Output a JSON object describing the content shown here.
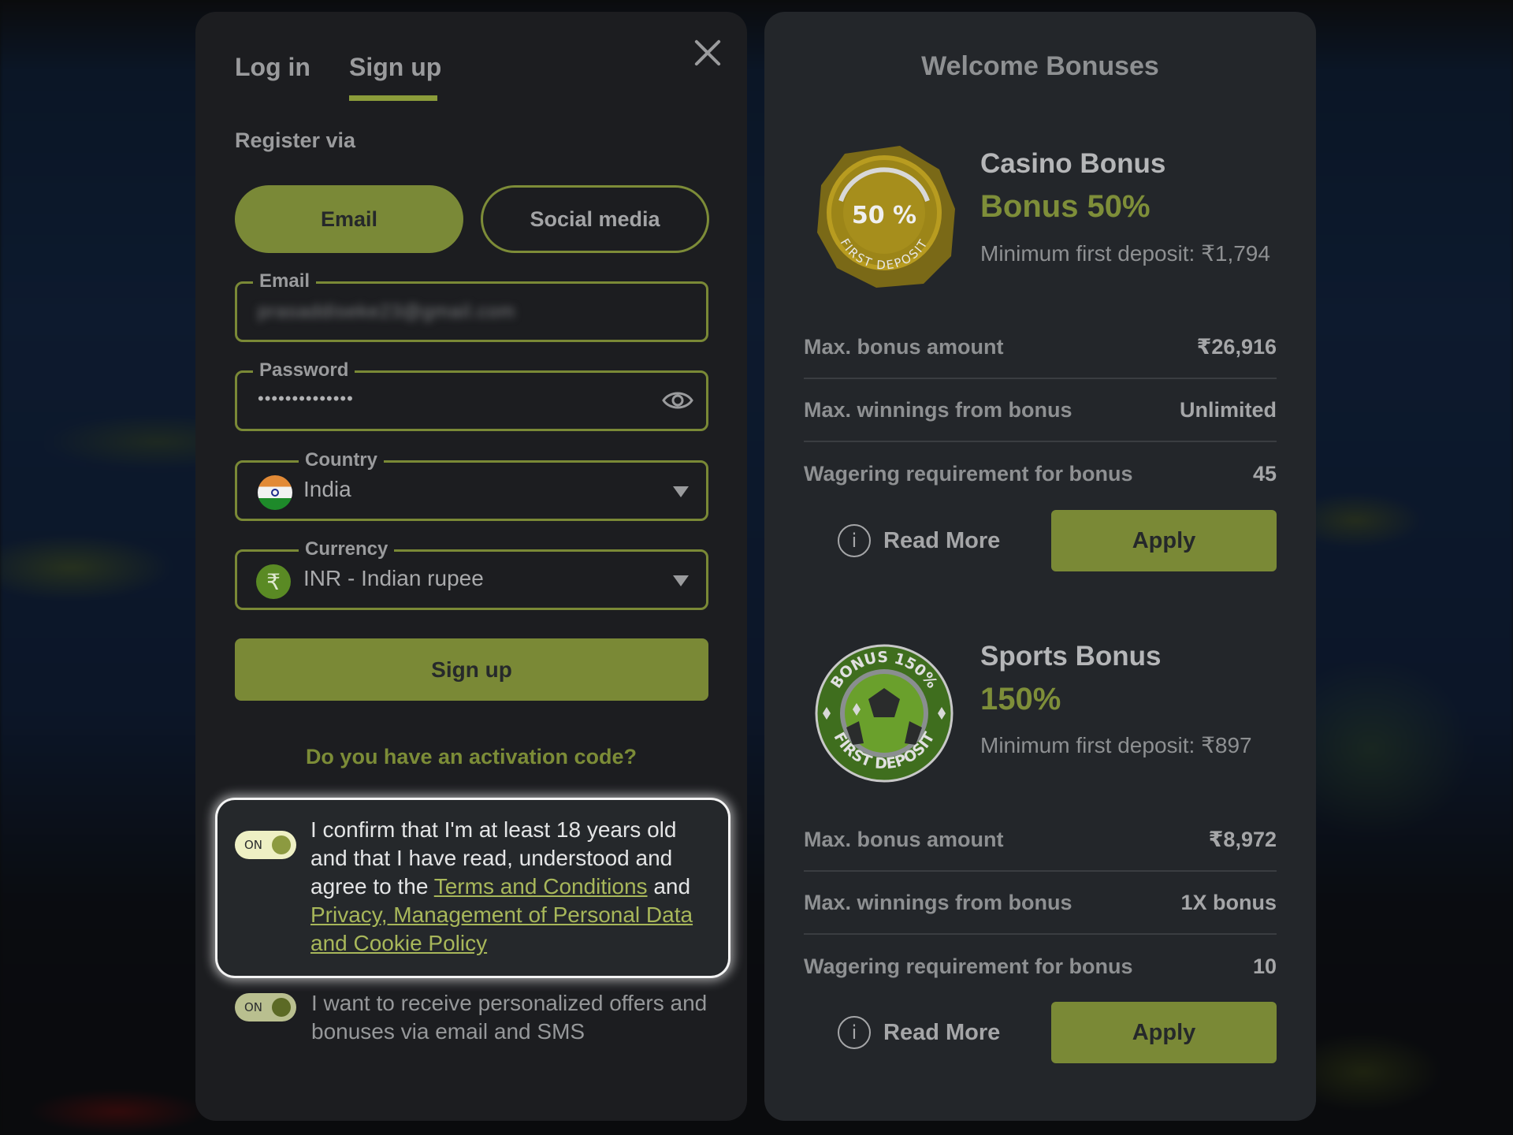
{
  "tabs": {
    "login": "Log in",
    "signup": "Sign up",
    "active": "signup"
  },
  "register_via": "Register via",
  "methods": {
    "email": "Email",
    "social": "Social media"
  },
  "form": {
    "email": {
      "label": "Email",
      "value": "prasaddiseke23@gmail.com"
    },
    "password": {
      "label": "Password",
      "value": "••••••••••••••"
    },
    "country": {
      "label": "Country",
      "value": "India"
    },
    "currency": {
      "label": "Currency",
      "value": "INR - Indian rupee",
      "symbol": "₹"
    },
    "submit": "Sign up"
  },
  "activation_link": "Do you have an activation code?",
  "consent": {
    "toggle_label": "ON",
    "text_before": "I confirm that I'm at least 18 years old and that I have read, understood and agree to the ",
    "terms_link": "Terms and Conditions",
    "text_middle": " and ",
    "privacy_link": "Privacy, Management of Personal Data and Cookie Policy"
  },
  "offers": {
    "toggle_label": "ON",
    "text": "I want to receive personalized offers and bonuses via email and SMS"
  },
  "bonuses": {
    "title": "Welcome Bonuses",
    "casino": {
      "badge_text": "50 %",
      "badge_subtext": "FIRST DEPOSIT",
      "name": "Casino Bonus",
      "percent": "Bonus 50%",
      "min_deposit": "Minimum first deposit: ₹1,794",
      "rows": [
        {
          "label": "Max. bonus amount",
          "value": "₹26,916"
        },
        {
          "label": "Max. winnings from bonus",
          "value": "Unlimited"
        },
        {
          "label": "Wagering requirement for bonus",
          "value": "45"
        }
      ],
      "read_more": "Read More",
      "apply": "Apply"
    },
    "sports": {
      "badge_text": "BONUS 150%",
      "badge_subtext": "FIRST DEPOSIT",
      "name": "Sports Bonus",
      "percent": "150%",
      "min_deposit": "Minimum first deposit: ₹897",
      "rows": [
        {
          "label": "Max. bonus amount",
          "value": "₹8,972"
        },
        {
          "label": "Max. winnings from bonus",
          "value": "1X bonus"
        },
        {
          "label": "Wagering requirement for bonus",
          "value": "10"
        }
      ],
      "read_more": "Read More",
      "apply": "Apply"
    }
  },
  "colors": {
    "accent": "#7a8936",
    "link": "#a8b75a",
    "panel_left": "#1c1d20",
    "panel_right": "#23262a"
  }
}
